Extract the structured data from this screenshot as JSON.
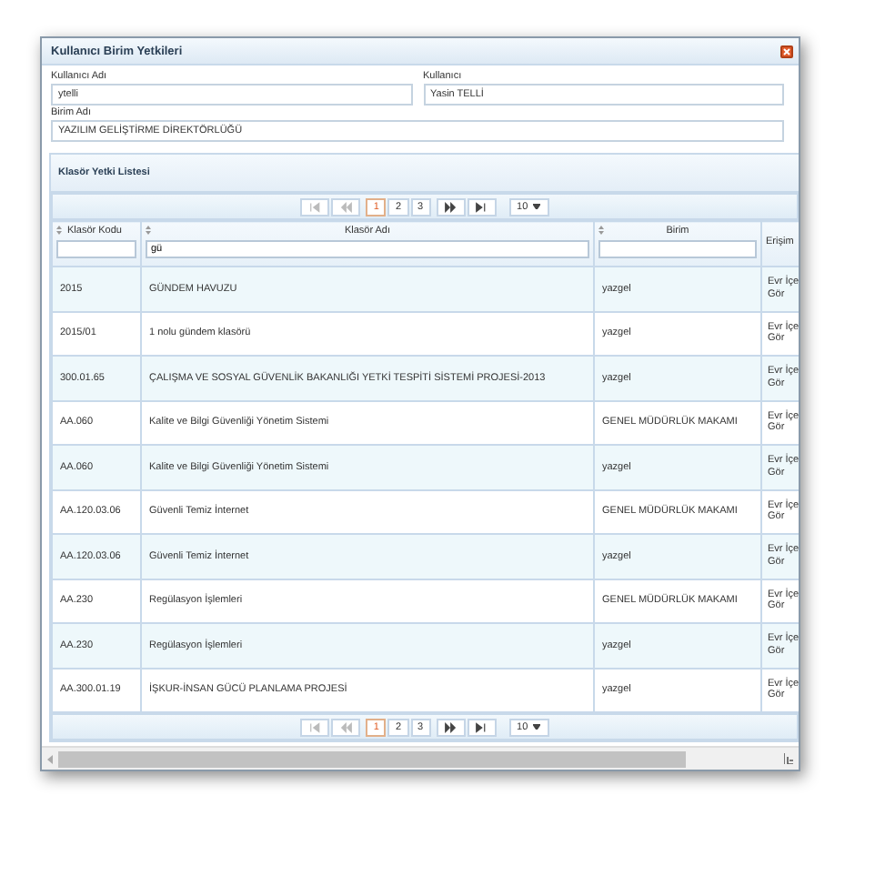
{
  "window": {
    "title": "Kullanıcı Birim Yetkileri"
  },
  "fields": [
    {
      "label": "Kullanıcı Adı",
      "value": "ytelli"
    },
    {
      "label": "Kullanıcı",
      "value": "Yasin TELLİ"
    },
    {
      "label": "Birim Adı",
      "value": "YAZILIM GELİŞTİRME DİREKTÖRLÜĞÜ"
    }
  ],
  "panel": {
    "title": "Klasör Yetki Listesi"
  },
  "pagers": [
    {
      "nav_before": [
        {
          "kind": "first",
          "disabled": true
        },
        {
          "kind": "prev",
          "disabled": true
        }
      ],
      "pages": [
        {
          "label": "1",
          "selected": true
        },
        {
          "label": "2",
          "selected": false
        },
        {
          "label": "3",
          "selected": false
        }
      ],
      "nav_after": [
        {
          "kind": "next",
          "disabled": false
        },
        {
          "kind": "last",
          "disabled": false
        }
      ],
      "page_size": "10"
    },
    {
      "nav_before": [
        {
          "kind": "first",
          "disabled": true
        },
        {
          "kind": "prev",
          "disabled": true
        }
      ],
      "pages": [
        {
          "label": "1",
          "selected": true
        },
        {
          "label": "2",
          "selected": false
        },
        {
          "label": "3",
          "selected": false
        }
      ],
      "nav_after": [
        {
          "kind": "next",
          "disabled": false
        },
        {
          "kind": "last",
          "disabled": false
        }
      ],
      "page_size": "10"
    }
  ],
  "table": {
    "columns": [
      {
        "label": "Klasör Kodu",
        "sortable": true,
        "has_filter": true
      },
      {
        "label": "Klasör Adı",
        "sortable": true,
        "has_filter": true,
        "filter_value": "gü"
      },
      {
        "label": "Birim",
        "sortable": true,
        "has_filter": true
      },
      {
        "label": "Erişim",
        "sortable": false,
        "has_filter": false
      }
    ],
    "rows": [
      [
        "2015",
        "GÜNDEM HAVUZU",
        "yazgel",
        "Evr İçe Gör"
      ],
      [
        "2015/01",
        "1 nolu gündem klasörü",
        "yazgel",
        "Evr İçe Gör"
      ],
      [
        "300.01.65",
        "ÇALIŞMA VE SOSYAL GÜVENLİK BAKANLIĞI YETKİ TESPİTİ SİSTEMİ PROJESİ-2013",
        "yazgel",
        "Evr İçe Gör"
      ],
      [
        "AA.060",
        "Kalite ve Bilgi Güvenliği Yönetim Sistemi",
        "GENEL MÜDÜRLÜK MAKAMI",
        "Evr İçe Gör"
      ],
      [
        "AA.060",
        "Kalite ve Bilgi Güvenliği Yönetim Sistemi",
        "yazgel",
        "Evr İçe Gör"
      ],
      [
        "AA.120.03.06",
        "Güvenli Temiz İnternet",
        "GENEL MÜDÜRLÜK MAKAMI",
        "Evr İçe Gör"
      ],
      [
        "AA.120.03.06",
        "Güvenli Temiz İnternet",
        "yazgel",
        "Evr İçe Gör"
      ],
      [
        "AA.230",
        "Regülasyon İşlemleri",
        "GENEL MÜDÜRLÜK MAKAMI",
        "Evr İçe Gör"
      ],
      [
        "AA.230",
        "Regülasyon İşlemleri",
        "yazgel",
        "Evr İçe Gör"
      ],
      [
        "AA.300.01.19",
        "İŞKUR-İNSAN GÜCÜ PLANLAMA PROJESİ",
        "yazgel",
        "Evr İçe Gör"
      ]
    ]
  }
}
